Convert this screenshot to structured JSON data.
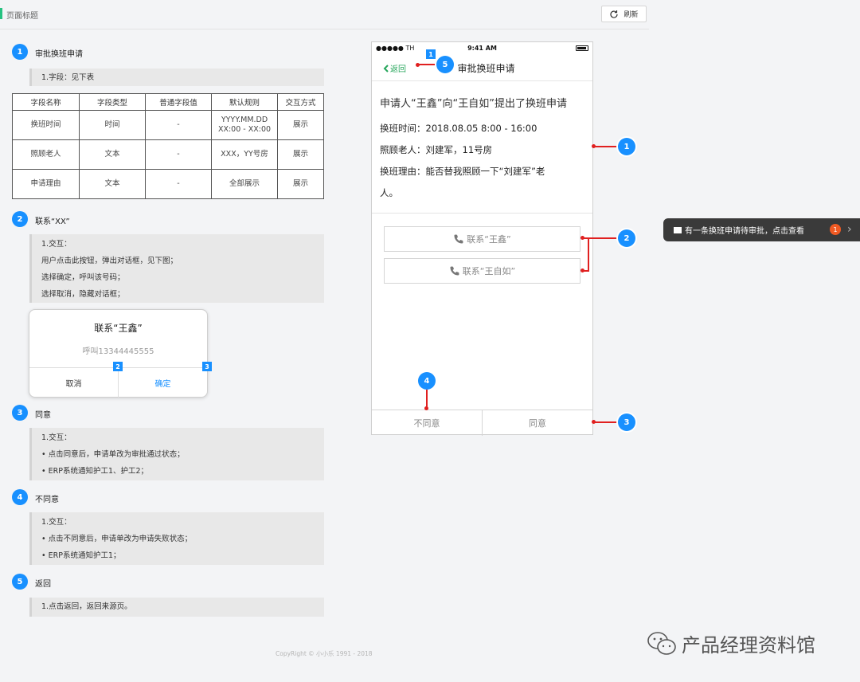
{
  "header": {
    "page_title": "页面标题",
    "refresh_label": "刷新"
  },
  "sections": [
    {
      "num": "1",
      "title": "审批换班申请",
      "lines": [
        "1.字段：见下表"
      ]
    },
    {
      "num": "2",
      "title": "联系“XX”",
      "lines": [
        "1.交互：",
        "用户点击此按钮，弹出对话框，见下图；",
        "选择确定，呼叫该号码；",
        "选择取消，隐藏对话框；"
      ]
    },
    {
      "num": "3",
      "title": "同意",
      "lines": [
        "1.交互：",
        "• 点击同意后，申请单改为审批通过状态；",
        "• ERP系统通知护工1、护工2；"
      ]
    },
    {
      "num": "4",
      "title": "不同意",
      "lines": [
        "1.交互：",
        "• 点击不同意后，申请单改为申请失败状态；",
        "• ERP系统通知护工1；"
      ]
    },
    {
      "num": "5",
      "title": "返回",
      "lines": [
        "1.点击返回，返回来源页。"
      ]
    }
  ],
  "field_table": {
    "headers": [
      "字段名称",
      "字段类型",
      "普通字段值",
      "默认规则",
      "交互方式"
    ],
    "rows": [
      [
        "换班时间",
        "时间",
        "-",
        "YYYY.MM.DD\nXX:00 - XX:00",
        "展示"
      ],
      [
        "照顾老人",
        "文本",
        "-",
        "XXX，YY号房",
        "展示"
      ],
      [
        "申请理由",
        "文本",
        "-",
        "全部展示",
        "展示"
      ]
    ]
  },
  "dialog": {
    "title": "联系“王鑫”",
    "message": "呼叫13344445555",
    "cancel": "取消",
    "confirm": "确定",
    "cancel_marker": "2",
    "confirm_marker": "3"
  },
  "phone": {
    "carrier": "●●●●● TH",
    "time": "9:41 AM",
    "back_label": "返回",
    "nav_title": "审批换班申请",
    "back_marker": "1",
    "headline": "申请人“王鑫”向“王自如”提出了换班申请",
    "info": [
      "换班时间：2018.08.05  8:00 - 16:00",
      "照顾老人：刘建军，11号房",
      "换班理由：能否替我照顾一下“刘建军”老",
      "人。"
    ],
    "contact_buttons": [
      "联系“王鑫”",
      "联系“王自如”"
    ],
    "disagree": "不同意",
    "agree": "同意"
  },
  "annotations": [
    "1",
    "2",
    "3",
    "4",
    "5"
  ],
  "toast": {
    "text": "有一条换班申请待审批，点击查看",
    "badge": "1"
  },
  "footer": {
    "copyright": "CopyRight © 小小乐  1991 - 2018",
    "watermark": "产品经理资料馆"
  },
  "colors": {
    "accent_blue": "#1890ff",
    "annotation_red": "#e02020",
    "back_green": "#26a65b",
    "toast_bg": "#3a3a3a",
    "badge_orange": "#f05a23"
  }
}
